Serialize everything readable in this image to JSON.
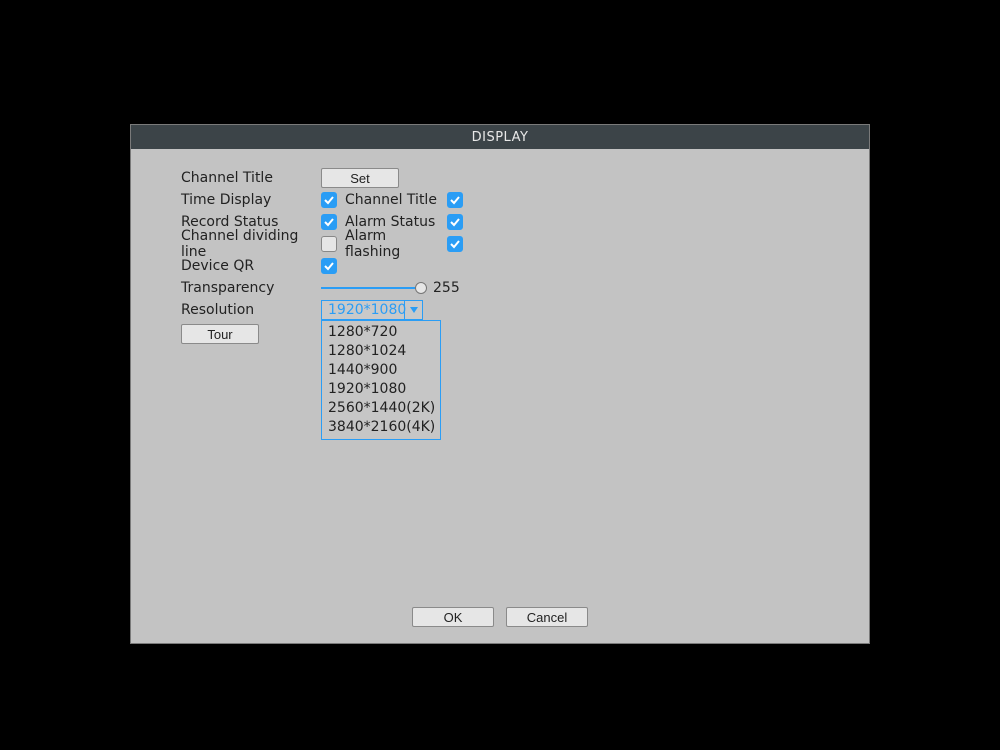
{
  "title": "DISPLAY",
  "labels": {
    "channel_title": "Channel Title",
    "time_display": "Time Display",
    "record_status": "Record Status",
    "channel_dividing_line": "Channel dividing line",
    "device_qr": "Device QR",
    "transparency": "Transparency",
    "resolution": "Resolution",
    "channel_title_cb": "Channel Title",
    "alarm_status": "Alarm Status",
    "alarm_flashing": "Alarm flashing"
  },
  "buttons": {
    "set": "Set",
    "tour": "Tour",
    "ok": "OK",
    "cancel": "Cancel"
  },
  "checkboxes": {
    "time_display": true,
    "channel_title_cb": true,
    "record_status": true,
    "alarm_status": true,
    "channel_dividing_line": false,
    "alarm_flashing": true,
    "device_qr": true
  },
  "transparency_value": "255",
  "resolution": {
    "selected": "1920*1080",
    "options": [
      "1280*720",
      "1280*1024",
      "1440*900",
      "1920*1080",
      "2560*1440(2K)",
      "3840*2160(4K)"
    ]
  }
}
